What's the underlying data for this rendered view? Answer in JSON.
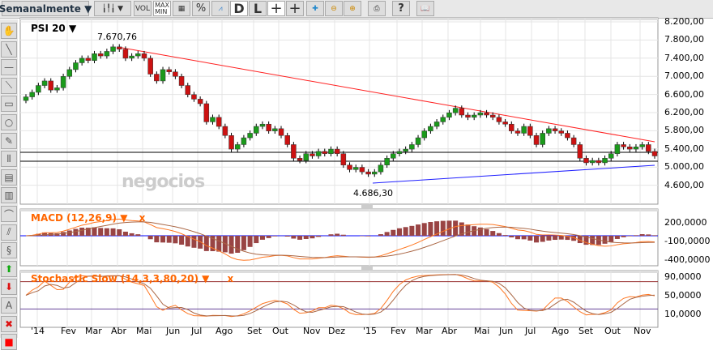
{
  "toolbar": {
    "period": "Semanalmente",
    "vol": "VOL",
    "maxmin": "MAX\nMIN",
    "percent": "%",
    "d": "D",
    "l": "L",
    "help": "?",
    "icons": [
      "candlestick-icon",
      "volume-icon",
      "maxmin-icon",
      "grid-icon",
      "percent-icon",
      "area-icon",
      "d-icon",
      "l-icon",
      "crosshair-icon",
      "crosshair-l-icon",
      "add-indicator-icon",
      "zoom-out-icon",
      "zoom-in-icon",
      "print-icon",
      "help-icon",
      "book-icon"
    ]
  },
  "left_tools": [
    "hand-icon",
    "line-icon",
    "horizontal-line-icon",
    "diagonal-icon",
    "rectangle-icon",
    "circle-icon",
    "pencil-icon",
    "fibonacci-icon",
    "grid-lines-icon",
    "levels-icon",
    "arc-icon",
    "channel-icon",
    "s-channel-icon",
    "up-arrow-icon",
    "down-arrow-icon",
    "text-icon",
    "delete-icon",
    "color-picker-icon"
  ],
  "colors": {
    "up": "#1a9a1a",
    "down": "#cc1111",
    "trend_red": "#ff2020",
    "trend_blue": "#2020ff",
    "ind": "#ff6600"
  },
  "main": {
    "symbol": "PSI 20",
    "max_label": "7.670,76",
    "min_label": "4.686,30",
    "watermark": "negocios",
    "yticks": [
      "8.200,00",
      "7.800,00",
      "7.400,00",
      "7.000,00",
      "6.600,00",
      "6.200,00",
      "5.800,00",
      "5.400,00",
      "5.000,00",
      "4.600,00"
    ]
  },
  "macd": {
    "title": "MACD (12,26,9)",
    "close": "x",
    "yticks": [
      "200,0000",
      "-100,0000",
      "-400,0000"
    ]
  },
  "stoch": {
    "title": "Stochastic Slow (14,3,3,80,20)",
    "close": "x",
    "yticks": [
      "90,0000",
      "50,0000",
      "10,0000"
    ]
  },
  "xaxis": [
    "'14",
    "Fev",
    "Mar",
    "Abr",
    "Mai",
    "Jun",
    "Jul",
    "Ago",
    "Set",
    "Out",
    "Nov",
    "Dez",
    "'15",
    "Fev",
    "Mar",
    "Abr",
    "Mai",
    "Jun",
    "Jul",
    "Ago",
    "Set",
    "Out",
    "Nov"
  ],
  "chart_data": {
    "type": "candlestick",
    "closes": [
      6550,
      6650,
      6800,
      6900,
      6700,
      6750,
      7000,
      7150,
      7300,
      7400,
      7350,
      7500,
      7450,
      7550,
      7650,
      7600,
      7400,
      7450,
      7500,
      7400,
      7050,
      6900,
      7150,
      7100,
      7000,
      6800,
      6600,
      6500,
      6400,
      6000,
      6100,
      5900,
      5700,
      5400,
      5500,
      5650,
      5750,
      5900,
      5950,
      5800,
      5850,
      5700,
      5500,
      5200,
      5150,
      5300,
      5250,
      5350,
      5300,
      5400,
      5300,
      5050,
      4950,
      5000,
      4900,
      4850,
      4900,
      5050,
      5200,
      5300,
      5350,
      5400,
      5500,
      5650,
      5800,
      5900,
      6000,
      6100,
      6200,
      6300,
      6150,
      6100,
      6150,
      6200,
      6150,
      6100,
      6000,
      5950,
      5800,
      5750,
      5900,
      5700,
      5500,
      5750,
      5850,
      5800,
      5750,
      5650,
      5500,
      5200,
      5100,
      5150,
      5100,
      5200,
      5300,
      5500,
      5450,
      5400,
      5450,
      5500,
      5350,
      5250
    ],
    "ylim": [
      4400,
      8300
    ]
  }
}
